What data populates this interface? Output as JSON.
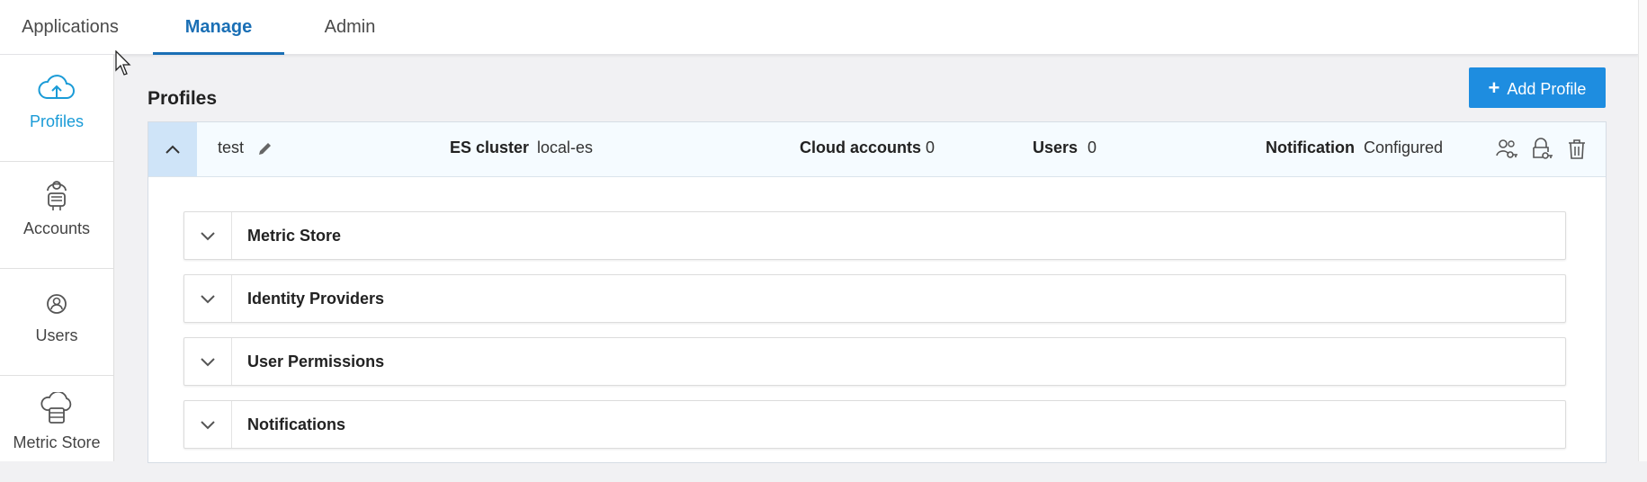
{
  "top_tabs": [
    {
      "label": "Applications",
      "active": false
    },
    {
      "label": "Manage",
      "active": true
    },
    {
      "label": "Admin",
      "active": false
    }
  ],
  "sidebar": {
    "items": [
      {
        "label": "Profiles",
        "icon": "cloud-upload-icon",
        "active": true
      },
      {
        "label": "Accounts",
        "icon": "accounts-icon",
        "active": false
      },
      {
        "label": "Users",
        "icon": "user-circle-icon",
        "active": false
      },
      {
        "label": "Metric Store",
        "icon": "metric-store-icon",
        "active": false
      }
    ]
  },
  "main": {
    "title": "Profiles",
    "add_button": {
      "plus": "+",
      "label": "Add Profile"
    },
    "profile": {
      "name": "test",
      "es_cluster_label": "ES cluster",
      "es_cluster_value": "local-es",
      "cloud_accounts_label": "Cloud accounts",
      "cloud_accounts_value": "0",
      "users_label": "Users",
      "users_value": "0",
      "notification_label": "Notification",
      "notification_value": "Configured",
      "sections": [
        {
          "title": "Metric Store"
        },
        {
          "title": "Identity Providers"
        },
        {
          "title": "User Permissions"
        },
        {
          "title": "Notifications"
        }
      ]
    }
  },
  "colors": {
    "accent": "#1a6fb5",
    "sidebar_active": "#1a9bd7",
    "button": "#1e8de0",
    "header_bg": "#f5fbff",
    "collapse_bg": "#cfe4f8"
  }
}
